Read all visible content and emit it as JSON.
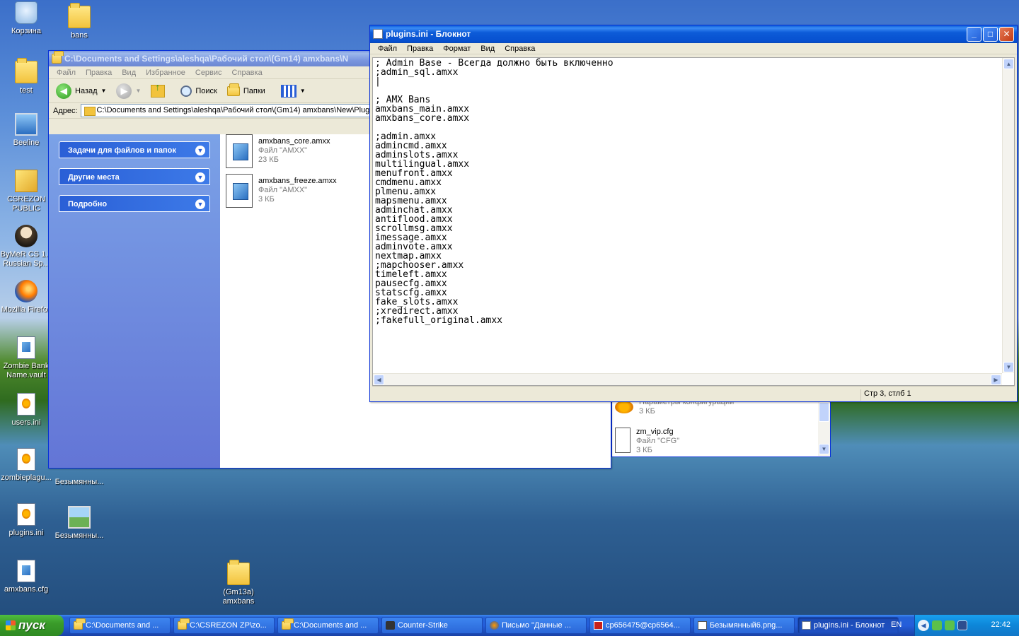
{
  "desktop": {
    "icons": [
      {
        "label": "Корзина"
      },
      {
        "label": "bans"
      },
      {
        "label": "test"
      },
      {
        "label": "Beeline"
      },
      {
        "label": "CSREZON PUBLIC"
      },
      {
        "label": "ByMeR CS 1.6 Russian Sp..."
      },
      {
        "label": "Mozilla Firefox"
      },
      {
        "label": "Zombie Bank Name.vault"
      },
      {
        "label": "users.ini"
      },
      {
        "label": "zombieplagu..."
      },
      {
        "label": "Безымянны..."
      },
      {
        "label": "plugins.ini"
      },
      {
        "label": "Безымянны..."
      },
      {
        "label": "amxbans.cfg"
      },
      {
        "label": "(Gm13a) amxbans"
      }
    ]
  },
  "explorer": {
    "title": "C:\\Documents and Settings\\aleshqa\\Рабочий стол\\(Gm14) amxbans\\N",
    "menu": [
      "Файл",
      "Правка",
      "Вид",
      "Избранное",
      "Сервис",
      "Справка"
    ],
    "toolbar": {
      "back": "Назад",
      "search": "Поиск",
      "folders": "Папки"
    },
    "address_label": "Адрес:",
    "address_value": "C:\\Documents and Settings\\aleshqa\\Рабочий стол\\(Gm14) amxbans\\New\\Plugin",
    "task_panes": [
      "Задачи для файлов и папок",
      "Другие места",
      "Подробно"
    ],
    "files": [
      {
        "name": "amxbans_core.amxx",
        "type": "Файл \"AMXX\"",
        "size": "23 КБ"
      },
      {
        "name": "amxbans_freeze.amxx",
        "type": "Файл \"AMXX\"",
        "size": "3 КБ"
      }
    ]
  },
  "notepad": {
    "title": "plugins.ini - Блокнот",
    "menu": [
      "Файл",
      "Правка",
      "Формат",
      "Вид",
      "Справка"
    ],
    "content": "; Admin Base - Всегда должно быть включенно\n;admin_sql.amxx\n|\n\n; AMX Bans\namxbans_main.amxx\namxbans_core.amxx\n\n;admin.amxx\nadmincmd.amxx\nadminslots.amxx\nmultilingual.amxx\nmenufront.amxx\ncmdmenu.amxx\nplmenu.amxx\nmapsmenu.amxx\nadminchat.amxx\nantiflood.amxx\nscrollmsg.amxx\nimessage.amxx\nadminvote.amxx\nnextmap.amxx\n;mapchooser.amxx\ntimeleft.amxx\npausecfg.amxx\nstatscfg.amxx\nfake_slots.amxx\n;xredirect.amxx\n;fakefull_original.amxx",
    "status": "Стр 3, стлб 1"
  },
  "third_window": {
    "files": [
      {
        "name": "Параметры конфигурации",
        "size": "3 КБ"
      },
      {
        "name": "zm_vip.cfg",
        "type": "Файл \"CFG\"",
        "size": "3 КБ"
      }
    ]
  },
  "taskbar": {
    "start": "пуск",
    "tasks": [
      {
        "label": "C:\\Documents and ..."
      },
      {
        "label": "C:\\CSREZON ZP\\zo..."
      },
      {
        "label": "C:\\Documents and ..."
      },
      {
        "label": "Counter-Strike"
      },
      {
        "label": "Письмо \"Данные ..."
      },
      {
        "label": "cp656475@cp6564..."
      },
      {
        "label": "Безымянный6.png..."
      },
      {
        "label": "plugins.ini - Блокнот"
      }
    ],
    "lang": "EN",
    "clock": "22:42"
  }
}
